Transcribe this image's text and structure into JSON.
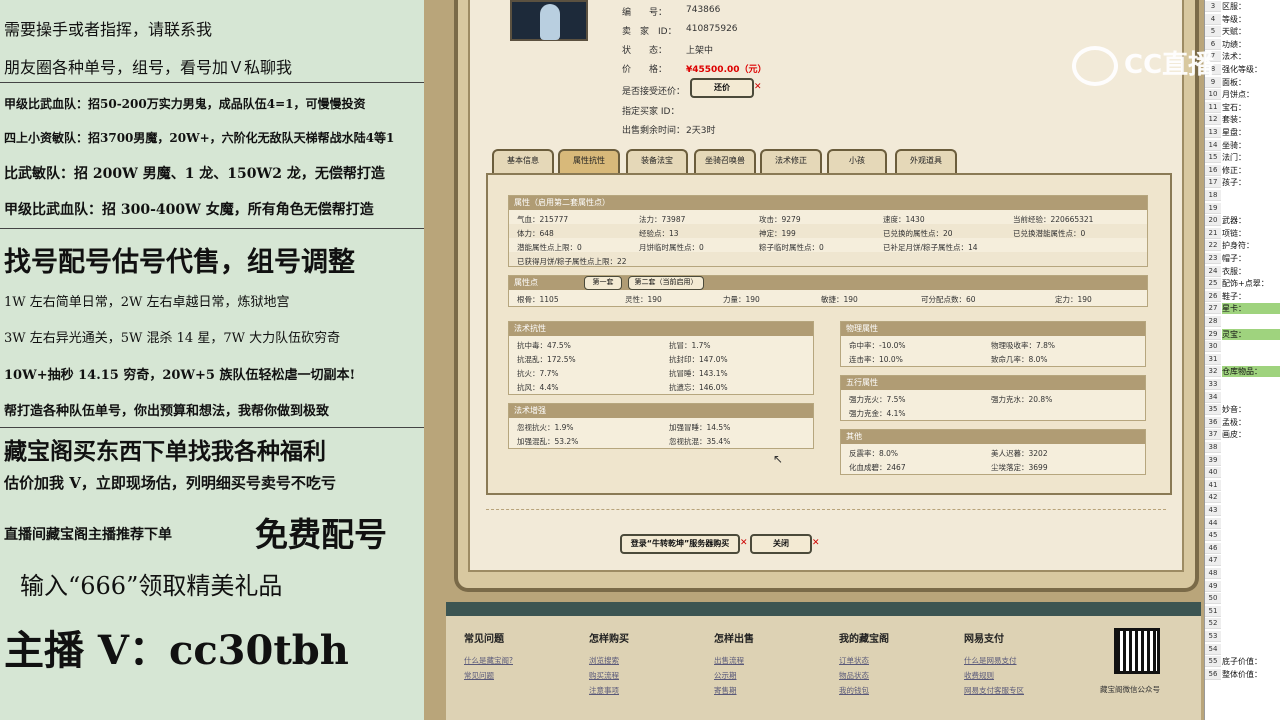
{
  "left_ads": [
    "需要操手或者指挥，请联系我",
    "朋友圈各种单号，组号，看号加Ｖ私聊我",
    "甲级比武血队：招50-200万实力男鬼，成品队伍4=1，可慢慢投资",
    "四上小资敏队：招3700男魔，20W+，六阶化无敌队天梯帮战水陆4等1",
    "比武敏队：招 200W 男魔、1 龙、150W2 龙，无偿帮打造",
    "甲级比武血队：招 300-400W 女魔，所有角色无偿帮打造",
    "找号配号估号代售，组号调整",
    "1W 左右简单日常，2W 左右卓越日常，炼狱地宫",
    "3W 左右异光通关，5W 混杀 14 星，7W 大力队伍砍穷奇",
    "10W+抽秒 14.15 穷奇，20W+5 族队伍轻松虐一切副本!",
    "帮打造各种队伍单号，你出预算和想法，我帮你做到极致",
    "藏宝阁买东西下单找我各种福利",
    "估价加我 V，立即现场估，列明细买号卖号不吃亏",
    "直播间藏宝阁主播推荐下单",
    "免费配号",
    "输入“666”领取精美礼品",
    "主播 V：cc30tbh"
  ],
  "item": {
    "id_label": "编　　号：",
    "id_value": "743866",
    "seller_label": "卖　家　ID：",
    "seller_value": "410875926",
    "status_label": "状　　态：",
    "status_value": "上架中",
    "price_label": "价　　格：",
    "price_value": "¥45500.00（元）",
    "bargain_label": "是否接受还价：",
    "bargain_button": "还价",
    "buyer_label": "指定买家 ID：",
    "buyer_value": "",
    "time_label": "出售剩余时间：",
    "time_value": "2天3时"
  },
  "tabs": [
    "基本信息",
    "属性抗性",
    "装备法宝",
    "坐骑召唤兽",
    "法术修正",
    "小孩",
    "外观道具"
  ],
  "attr": {
    "title": "属性（启用第二套属性点）",
    "rows": [
      [
        "气血：215777",
        "法力：73987",
        "攻击：9279",
        "速度：1430",
        "当前经验：220665321"
      ],
      [
        "体力：648",
        "经验点：13",
        "神定：199",
        "已兑换的属性点：20",
        "已兑换潜能属性点：0"
      ],
      [
        "潜能属性点上限：0",
        "月饼临时属性点：0",
        "粽子临时属性点：0",
        "已补足月饼/粽子属性点：14",
        ""
      ],
      [
        "已获得月饼/粽子属性点上限：22",
        "",
        "",
        "",
        ""
      ]
    ]
  },
  "points": {
    "title": "属性点",
    "sub_tabs": [
      "第一套",
      "第二套（当前启用）"
    ],
    "values": [
      "根骨：1105",
      "灵性：190",
      "力量：190",
      "敏捷：190",
      "可分配点数：60",
      "定力：190"
    ]
  },
  "resist": {
    "title": "法术抗性",
    "rows": [
      [
        "抗中毒：47.5%",
        "抗冒：1.7%"
      ],
      [
        "抗混乱：172.5%",
        "抗封印：147.0%"
      ],
      [
        "抗火：7.7%",
        "抗冒睡：143.1%"
      ],
      [
        "抗风：4.4%",
        "抗遗忘：146.0%"
      ]
    ]
  },
  "boost": {
    "title": "法术增强",
    "rows": [
      [
        "忽视抗火：1.9%",
        "加强冒睡：14.5%"
      ],
      [
        "加强混乱：53.2%",
        "忽视抗混：35.4%"
      ]
    ]
  },
  "phys": {
    "title": "物理属性",
    "rows": [
      [
        "命中率：-10.0%",
        "物理吸收率：7.8%"
      ],
      [
        "连击率：10.0%",
        "致命几率：8.0%"
      ]
    ]
  },
  "five": {
    "title": "五行属性",
    "rows": [
      [
        "强力克火：7.5%",
        "强力克水：20.8%"
      ],
      [
        "强力克金：4.1%",
        ""
      ]
    ]
  },
  "other": {
    "title": "其他",
    "rows": [
      [
        "反震率：8.0%",
        "美人迟暮：3202"
      ],
      [
        "化血成碧：2467",
        "尘埃落定：3699"
      ]
    ]
  },
  "actions": {
    "login": "登录“牛转乾坤”服务器购买",
    "close": "关闭"
  },
  "footer": {
    "cols": [
      {
        "title": "常见问题",
        "links": [
          "什么是藏宝阁?",
          "常见问题"
        ]
      },
      {
        "title": "怎样购买",
        "links": [
          "浏览搜索",
          "购买流程",
          "注意事项"
        ]
      },
      {
        "title": "怎样出售",
        "links": [
          "出售流程",
          "公示期",
          "寄售期"
        ]
      },
      {
        "title": "我的藏宝阁",
        "links": [
          "订单状态",
          "物品状态",
          "我的钱包"
        ]
      },
      {
        "title": "网易支付",
        "links": [
          "什么是网易支付",
          "收费规则",
          "网易支付客服专区"
        ]
      }
    ],
    "qr_caption": "藏宝阁微信公众号"
  },
  "logo": "CC直播",
  "sheet": {
    "rows": [
      [
        "3",
        "区服："
      ],
      [
        "4",
        "等级："
      ],
      [
        "5",
        "天赋："
      ],
      [
        "6",
        "功绩："
      ],
      [
        "7",
        "法术："
      ],
      [
        "8",
        "强化等级："
      ],
      [
        "9",
        "面板："
      ],
      [
        "10",
        "月饼点："
      ],
      [
        "11",
        "宝石："
      ],
      [
        "12",
        "套装："
      ],
      [
        "13",
        "星盘："
      ],
      [
        "14",
        "坐骑："
      ],
      [
        "15",
        "法门："
      ],
      [
        "16",
        "修正："
      ],
      [
        "17",
        "孩子："
      ],
      [
        "18",
        ""
      ],
      [
        "19",
        ""
      ],
      [
        "20",
        "武器："
      ],
      [
        "21",
        "项链："
      ],
      [
        "22",
        "护身符："
      ],
      [
        "23",
        "帽子："
      ],
      [
        "24",
        "衣服："
      ],
      [
        "25",
        "配饰+点翠："
      ],
      [
        "26",
        "鞋子："
      ],
      [
        "27",
        "星卡："
      ],
      [
        "28",
        ""
      ],
      [
        "29",
        "灵宝："
      ],
      [
        "30",
        ""
      ],
      [
        "31",
        ""
      ],
      [
        "32",
        "仓库物品："
      ],
      [
        "33",
        ""
      ],
      [
        "34",
        ""
      ],
      [
        "35",
        "妙音："
      ],
      [
        "36",
        "孟极："
      ],
      [
        "37",
        "画皮："
      ],
      [
        "38",
        ""
      ],
      [
        "39",
        ""
      ],
      [
        "40",
        ""
      ],
      [
        "41",
        ""
      ],
      [
        "42",
        ""
      ],
      [
        "43",
        ""
      ],
      [
        "44",
        ""
      ],
      [
        "45",
        ""
      ],
      [
        "46",
        ""
      ],
      [
        "47",
        ""
      ],
      [
        "48",
        ""
      ],
      [
        "49",
        ""
      ],
      [
        "50",
        ""
      ],
      [
        "51",
        ""
      ],
      [
        "52",
        ""
      ],
      [
        "53",
        ""
      ],
      [
        "54",
        ""
      ],
      [
        "55",
        "底子价值："
      ],
      [
        "56",
        "整体价值："
      ]
    ],
    "highlight_rows": [
      24,
      26,
      29
    ]
  }
}
